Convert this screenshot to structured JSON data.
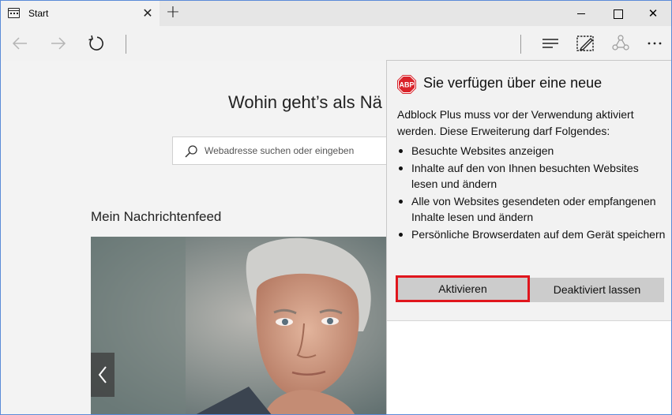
{
  "tab": {
    "title": "Start",
    "close_glyph": "✕",
    "new_tab_glyph": "+"
  },
  "window_controls": {
    "close_glyph": "✕"
  },
  "navbar": {
    "icons": [
      "back-arrow-icon",
      "forward-arrow-icon",
      "refresh-icon",
      "hub-icon",
      "web-note-icon",
      "share-icon",
      "more-icon"
    ]
  },
  "page": {
    "heading": "Wohin geht’s als Nä",
    "search": {
      "placeholder": "Webadresse suchen oder eingeben"
    },
    "feed_title": "Mein Nachrichtenfeed"
  },
  "popup": {
    "logo_text": "ABP",
    "title": "Sie verfügen über eine neue",
    "description": "Adblock Plus muss vor der Verwendung aktiviert werden. Diese Erweiterung darf Folgendes:",
    "permissions": [
      "Besuchte Websites anzeigen",
      "Inhalte auf den von Ihnen besuchten Websites lesen und ändern",
      "Alle von Websites gesendeten oder empfangenen Inhalte lesen und ändern",
      "Persönliche Browserdaten auf dem Gerät speichern"
    ],
    "activate_label": "Aktivieren",
    "disable_label": "Deaktiviert lassen"
  },
  "colors": {
    "accent_border": "#e0161d",
    "abp_red": "#d9232a",
    "window_border": "#5b8bd8"
  }
}
